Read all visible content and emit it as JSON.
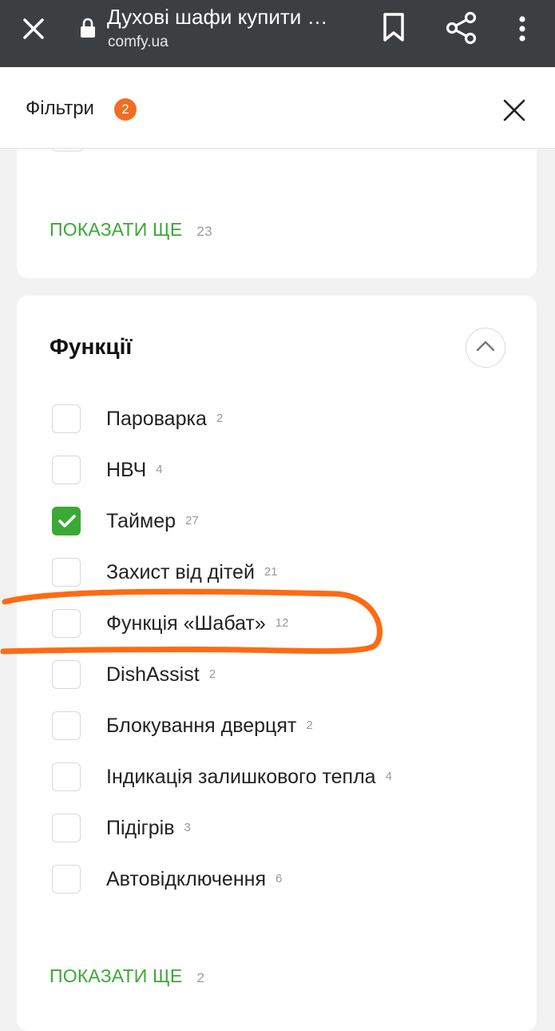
{
  "browser": {
    "title": "Духові шафи купити …",
    "url": "comfy.ua",
    "close_icon": "close-icon",
    "lock_icon": "lock-icon",
    "bookmark_icon": "bookmark-icon",
    "share_icon": "share-icon",
    "menu_icon": "more-vert-icon"
  },
  "filters": {
    "title": "Фільтри",
    "active_count": "2"
  },
  "prev_section": {
    "show_more": "ПОКАЗАТИ ЩЕ",
    "show_more_count": "23"
  },
  "functions": {
    "title": "Функції",
    "options": [
      {
        "label": "Пароварка",
        "count": "2",
        "checked": false
      },
      {
        "label": "НВЧ",
        "count": "4",
        "checked": false
      },
      {
        "label": "Таймер",
        "count": "27",
        "checked": true
      },
      {
        "label": "Захист від дітей",
        "count": "21",
        "checked": false
      },
      {
        "label": "Функція «Шабат»",
        "count": "12",
        "checked": false
      },
      {
        "label": "DishAssist",
        "count": "2",
        "checked": false
      },
      {
        "label": "Блокування дверцят",
        "count": "2",
        "checked": false
      },
      {
        "label": "Індикація залишкового тепла",
        "count": "4",
        "checked": false
      },
      {
        "label": "Підігрів",
        "count": "3",
        "checked": false
      },
      {
        "label": "Автовідключення",
        "count": "6",
        "checked": false
      }
    ],
    "show_more": "ПОКАЗАТИ ЩЕ",
    "show_more_count": "2"
  },
  "colors": {
    "accent_green": "#3aa935",
    "badge_orange": "#f26d21",
    "annotation_orange": "#ff6a13",
    "topbar": "#3c3f41"
  }
}
